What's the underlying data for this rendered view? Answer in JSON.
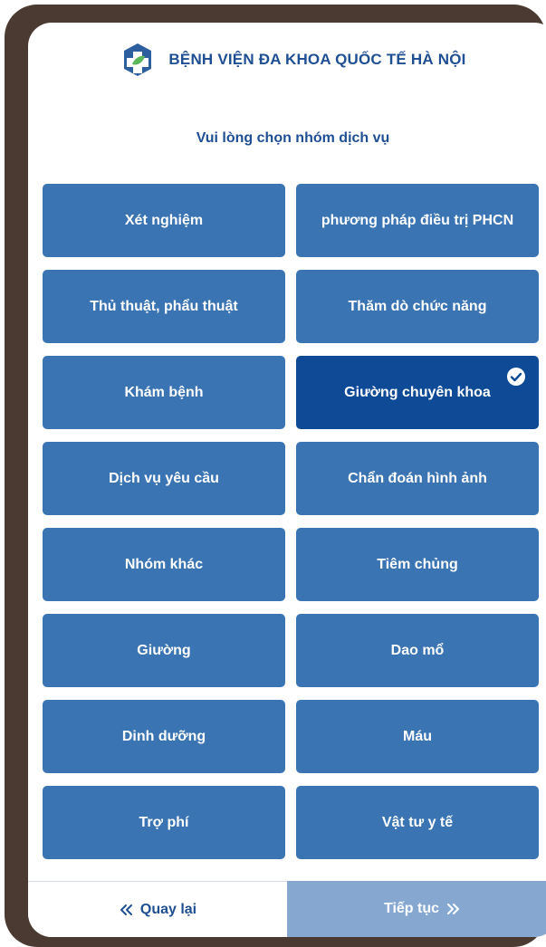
{
  "header": {
    "logo_icon": "hospital-cross-leaf-logo",
    "hospital_name": "BỆNH VIỆN ĐA KHOA QUỐC TẾ HÀ NỘI"
  },
  "prompt": "Vui lòng chọn nhóm dịch vụ",
  "services": [
    {
      "label": "Xét nghiệm",
      "selected": false
    },
    {
      "label": "phương pháp điều trị PHCN",
      "selected": false
    },
    {
      "label": "Thủ thuật, phẩu thuật",
      "selected": false
    },
    {
      "label": "Thăm dò chức năng",
      "selected": false
    },
    {
      "label": "Khám bệnh",
      "selected": false
    },
    {
      "label": "Giường chuyên khoa",
      "selected": true
    },
    {
      "label": "Dịch vụ yêu cầu",
      "selected": false
    },
    {
      "label": "Chẩn đoán hình ảnh",
      "selected": false
    },
    {
      "label": "Nhóm khác",
      "selected": false
    },
    {
      "label": "Tiêm chủng",
      "selected": false
    },
    {
      "label": "Giường",
      "selected": false
    },
    {
      "label": "Dao mổ",
      "selected": false
    },
    {
      "label": "Dinh dưỡng",
      "selected": false
    },
    {
      "label": "Máu",
      "selected": false
    },
    {
      "label": "Trợ phí",
      "selected": false
    },
    {
      "label": "Vật tư y tế",
      "selected": false
    }
  ],
  "footer": {
    "back_label": "Quay lại",
    "next_label": "Tiếp tục"
  },
  "colors": {
    "primary": "#3a74b2",
    "selected": "#0f4a96",
    "title": "#1f4f93",
    "next_disabled": "#86a8d0",
    "frame": "#4a3a32"
  }
}
